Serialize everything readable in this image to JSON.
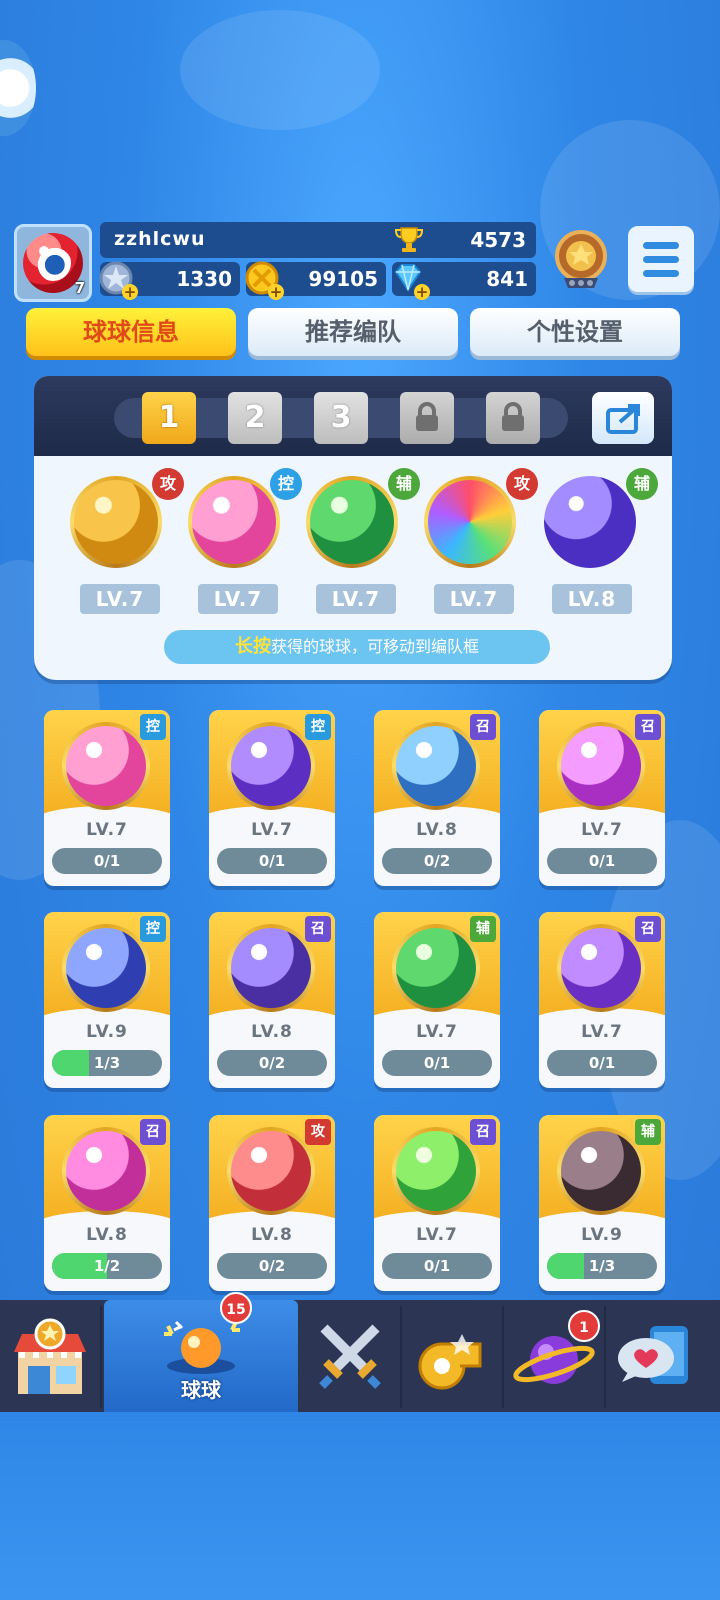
{
  "player": {
    "name": "zzhlcwu",
    "avatar_level": "7",
    "trophies": "4573",
    "stamina": "1330",
    "gold": "99105",
    "diamonds": "841"
  },
  "top_tabs": [
    {
      "label": "球球信息",
      "active": true
    },
    {
      "label": "推荐编队",
      "active": false
    },
    {
      "label": "个性设置",
      "active": false
    }
  ],
  "team_slots": [
    {
      "label": "1",
      "active": true
    },
    {
      "label": "2",
      "active": false
    },
    {
      "label": "3",
      "active": false
    },
    {
      "label": "",
      "locked": true
    },
    {
      "label": "",
      "locked": true
    }
  ],
  "team": [
    {
      "role": "攻",
      "level": "LV.7",
      "theme": "gold-knight"
    },
    {
      "role": "控",
      "level": "LV.7",
      "theme": "pink-heart"
    },
    {
      "role": "辅",
      "level": "LV.7",
      "theme": "green-arrow"
    },
    {
      "role": "攻",
      "level": "LV.7",
      "theme": "rainbow-gem"
    },
    {
      "role": "辅",
      "level": "LV.8",
      "theme": "blue-swap"
    }
  ],
  "hint": {
    "highlight": "长按",
    "text": "获得的球球，可移动到编队框"
  },
  "cards": [
    {
      "role": "控",
      "level": "LV.7",
      "progress": "0/1",
      "fill": 0,
      "theme": "pink-heart"
    },
    {
      "role": "控",
      "level": "LV.7",
      "progress": "0/1",
      "fill": 0,
      "theme": "purple-butterfly"
    },
    {
      "role": "召",
      "level": "LV.8",
      "progress": "0/2",
      "fill": 0,
      "theme": "blue-vortex"
    },
    {
      "role": "召",
      "level": "LV.7",
      "progress": "0/1",
      "fill": 0,
      "theme": "pink-mushroom"
    },
    {
      "role": "控",
      "level": "LV.9",
      "progress": "1/3",
      "fill": 0.333,
      "theme": "blue-clock"
    },
    {
      "role": "召",
      "level": "LV.8",
      "progress": "0/2",
      "fill": 0,
      "theme": "purple-ghost"
    },
    {
      "role": "辅",
      "level": "LV.7",
      "progress": "0/1",
      "fill": 0,
      "theme": "green-arrow"
    },
    {
      "role": "召",
      "level": "LV.7",
      "progress": "0/1",
      "fill": 0,
      "theme": "purple-planet"
    },
    {
      "role": "召",
      "level": "LV.8",
      "progress": "1/2",
      "fill": 0.5,
      "theme": "pink-blade"
    },
    {
      "role": "攻",
      "level": "LV.8",
      "progress": "0/2",
      "fill": 0,
      "theme": "red-fist"
    },
    {
      "role": "召",
      "level": "LV.7",
      "progress": "0/1",
      "fill": 0,
      "theme": "green-star"
    },
    {
      "role": "辅",
      "level": "LV.9",
      "progress": "1/3",
      "fill": 0.333,
      "theme": "dark-skull"
    }
  ],
  "bottom_nav": {
    "shop": {
      "icon": "shop-icon"
    },
    "balls": {
      "label": "球球",
      "badge": "15",
      "icon": "balls-icon"
    },
    "battle": {
      "icon": "crossed-swords-icon"
    },
    "whistle": {
      "icon": "whistle-icon"
    },
    "planet": {
      "badge": "1",
      "icon": "planet-icon"
    },
    "social": {
      "icon": "chat-heart-icon"
    }
  },
  "colors": {
    "role_attack": "#d23a32",
    "role_control": "#2a9adf",
    "role_summon": "#6c4fd2",
    "role_support": "#4ca83a"
  }
}
